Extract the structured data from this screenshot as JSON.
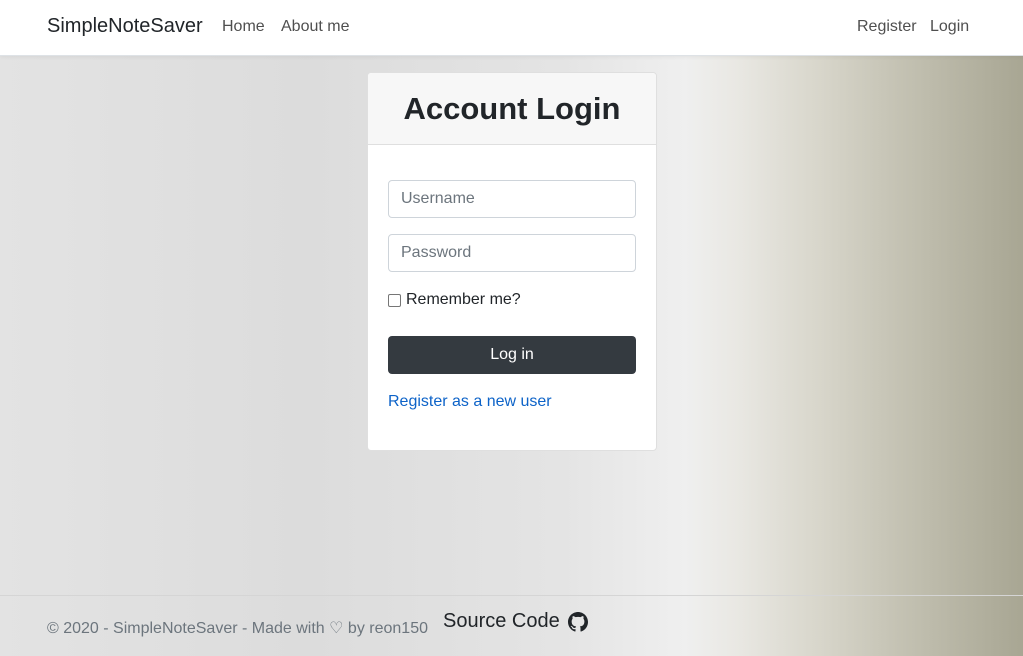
{
  "navbar": {
    "brand": "SimpleNoteSaver",
    "links": [
      "Home",
      "About me"
    ],
    "right_links": [
      "Register",
      "Login"
    ]
  },
  "login_card": {
    "title": "Account Login",
    "username_placeholder": "Username",
    "password_placeholder": "Password",
    "remember_label": "Remember me?",
    "login_button": "Log in",
    "register_link": "Register as a new user"
  },
  "footer": {
    "text": "© 2020 - SimpleNoteSaver - Made with ♡ by reon150",
    "source_label": "Source Code",
    "source_icon": "github-icon"
  },
  "colors": {
    "navbar_bg": "#ffffff",
    "button_bg": "#343a40",
    "link": "#0d63c8",
    "muted_text": "#6c757d"
  }
}
